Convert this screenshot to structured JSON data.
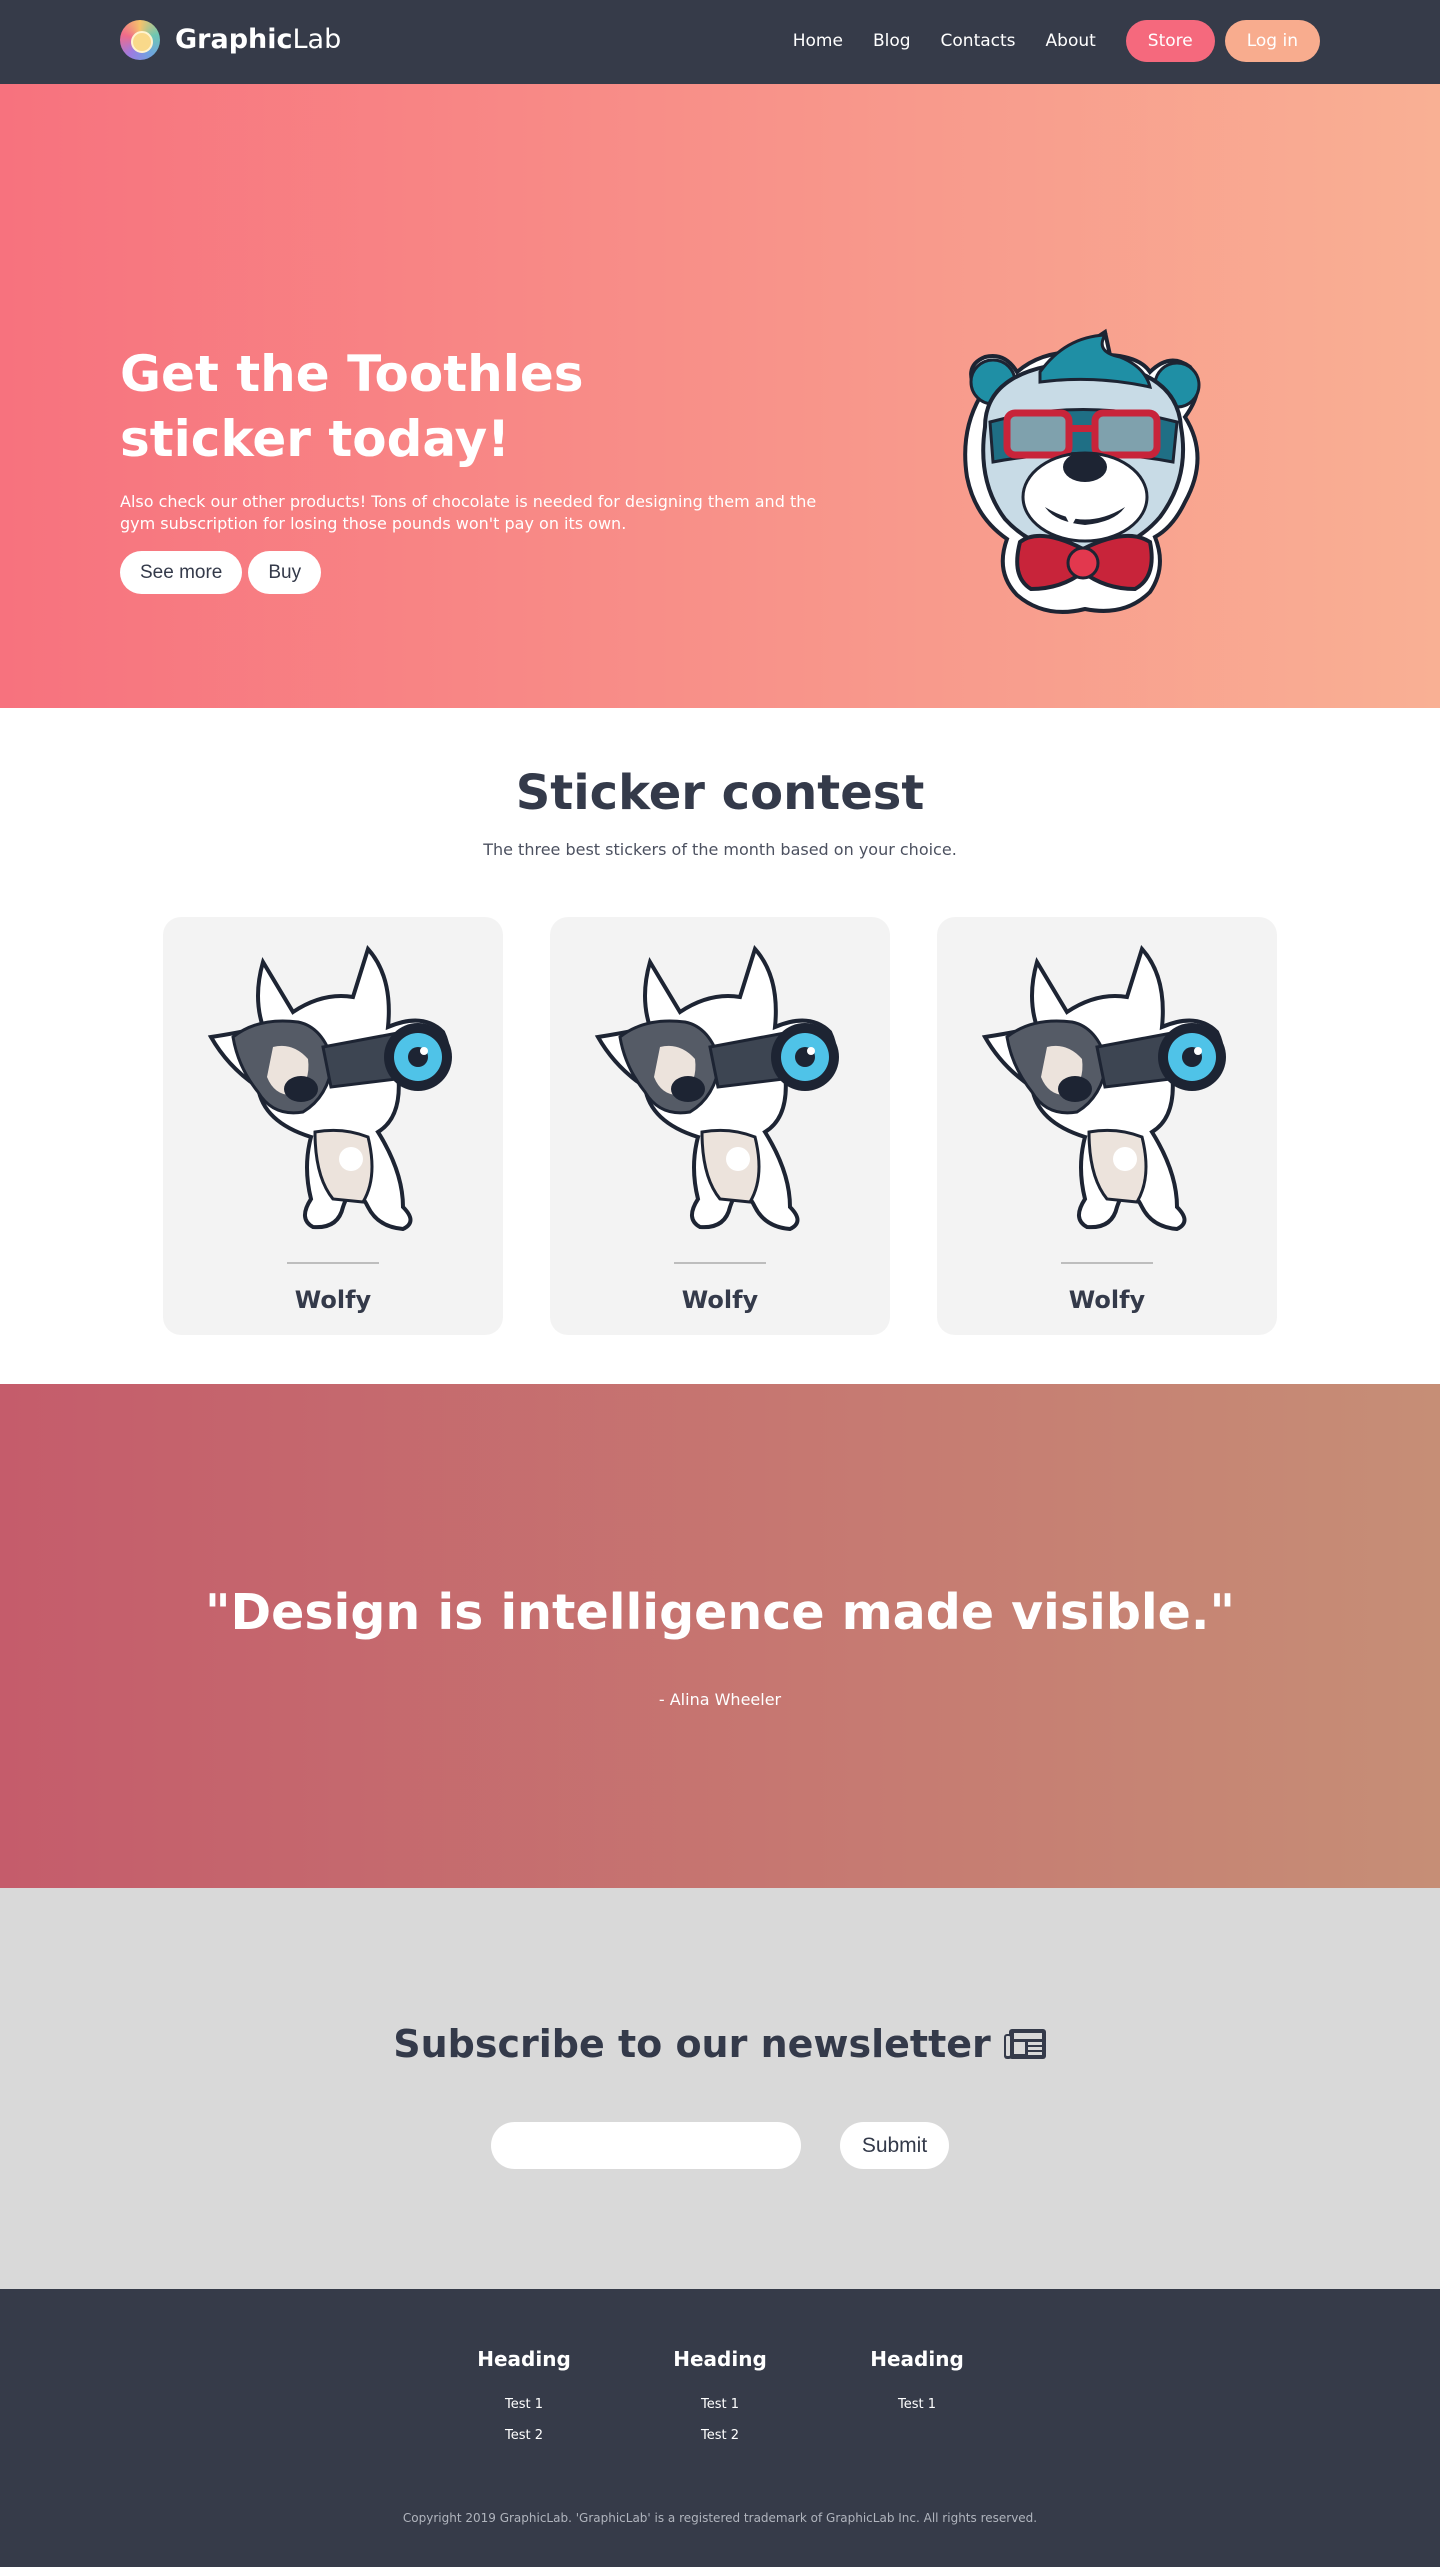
{
  "navbar": {
    "brand_bold": "Graphic",
    "brand_light": "Lab",
    "links": [
      "Home",
      "Blog",
      "Contacts",
      "About"
    ],
    "store_label": "Store",
    "login_label": "Log in",
    "colors": {
      "bg": "#363b49",
      "store": "#f5697d",
      "login": "#f8ac8e"
    }
  },
  "hero": {
    "title": "Get the Toothles sticker today!",
    "subtitle": "Also check our other products! Tons of chocolate is needed for designing them and the gym subscription for losing those pounds won't pay on its own.",
    "see_more_label": "See more",
    "buy_label": "Buy",
    "image_icon": "raccoon-sticker",
    "gradient": [
      "#f7727e",
      "#f9b094"
    ]
  },
  "contest": {
    "title": "Sticker contest",
    "subtitle": "The three best stickers of the month based on your choice.",
    "cards": [
      {
        "name": "Wolfy",
        "image_icon": "husky-binoculars-sticker"
      },
      {
        "name": "Wolfy",
        "image_icon": "husky-binoculars-sticker"
      },
      {
        "name": "Wolfy",
        "image_icon": "husky-binoculars-sticker"
      }
    ]
  },
  "quote": {
    "text": "\"Design is intelligence made visible.\"",
    "author": "- Alina Wheeler",
    "gradient": [
      "#c55c6b",
      "#c68e76"
    ]
  },
  "newsletter": {
    "title": "Subscribe to our newsletter",
    "title_icon": "newspaper-icon",
    "email_value": "",
    "submit_label": "Submit"
  },
  "footer": {
    "columns": [
      {
        "heading": "Heading",
        "links": [
          "Test 1",
          "Test 2"
        ]
      },
      {
        "heading": "Heading",
        "links": [
          "Test 1",
          "Test 2"
        ]
      },
      {
        "heading": "Heading",
        "links": [
          "Test 1"
        ]
      }
    ],
    "copyright": "Copyright 2019 GraphicLab. 'GraphicLab' is a registered trademark of GraphicLab Inc. All rights reserved."
  }
}
